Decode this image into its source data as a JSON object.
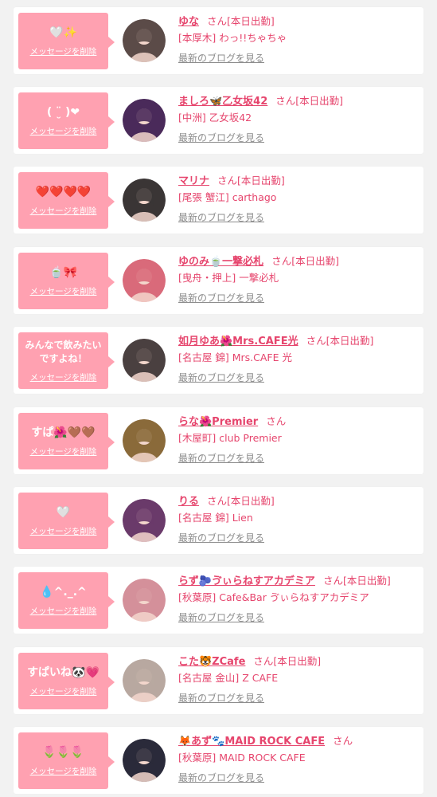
{
  "delete_label": "メッセージを削除",
  "blog_label": "最新のブログを見る",
  "colors": {
    "bubble": "#ffa1b1",
    "accent": "#e6456d",
    "muted": "#8d8d8d",
    "background": "#f2f2f2"
  },
  "cards": [
    {
      "message": "🤍✨",
      "name": "ゆな",
      "suffix": "さん",
      "status": "[本日出勤]",
      "shop": "[本厚木] わっ!!ちゃちゃ",
      "avatar_color": "#5b4b48"
    },
    {
      "message": "( ¨̮ )❤",
      "name": "ましろ🦋乙女坂42",
      "suffix": "さん",
      "status": "[本日出勤]",
      "shop": "[中洲] 乙女坂42",
      "avatar_color": "#4a2a5a"
    },
    {
      "message": "❤️❤️❤️❤️",
      "name": "マリナ",
      "suffix": "さん",
      "status": "[本日出勤]",
      "shop": "[尾張 蟹江] carthago",
      "avatar_color": "#3a3535"
    },
    {
      "message": "🍵🎀",
      "name": "ゆのみ🍵一撃必札",
      "suffix": "さん",
      "status": "[本日出勤]",
      "shop": "[曳舟・押上] 一撃必札",
      "avatar_color": "#d96a7a"
    },
    {
      "message": "みんなで飲みたい\nですよね！",
      "name": "如月ゆあ🌺Mrs.CAFE光",
      "suffix": "さん",
      "status": "[本日出勤]",
      "shop": "[名古屋 錦] Mrs.CAFE 光",
      "avatar_color": "#4a4040"
    },
    {
      "message": "すぱ🌺🤎🤎",
      "name": "らな🌺Premier",
      "suffix": "さん",
      "status": "",
      "shop": "[木屋町] club Premier",
      "avatar_color": "#8a6a3a"
    },
    {
      "message": "🤍",
      "name": "りる",
      "suffix": "さん",
      "status": "[本日出勤]",
      "shop": "[名古屋 錦] Lien",
      "avatar_color": "#6a3a6a"
    },
    {
      "message": "💧^._.^",
      "name": "らず🫐ゔぃらねすアカデミア",
      "suffix": "さん",
      "status": "[本日出勤]",
      "shop": "[秋葉原] Cafe&Bar ゔぃらねすアカデミア",
      "avatar_color": "#d4909a"
    },
    {
      "message": "すぱいね🐼💗",
      "name": "こた🐯ZCafe",
      "suffix": "さん",
      "status": "[本日出勤]",
      "shop": "[名古屋 金山] Z CAFE",
      "avatar_color": "#b8a8a0"
    },
    {
      "message": "🌷🌷🌷",
      "name": "🦊あず🐾MAID ROCK CAFE",
      "suffix": "さん",
      "status": "",
      "shop": "[秋葉原] MAID ROCK CAFE",
      "avatar_color": "#2a2a3a"
    }
  ]
}
